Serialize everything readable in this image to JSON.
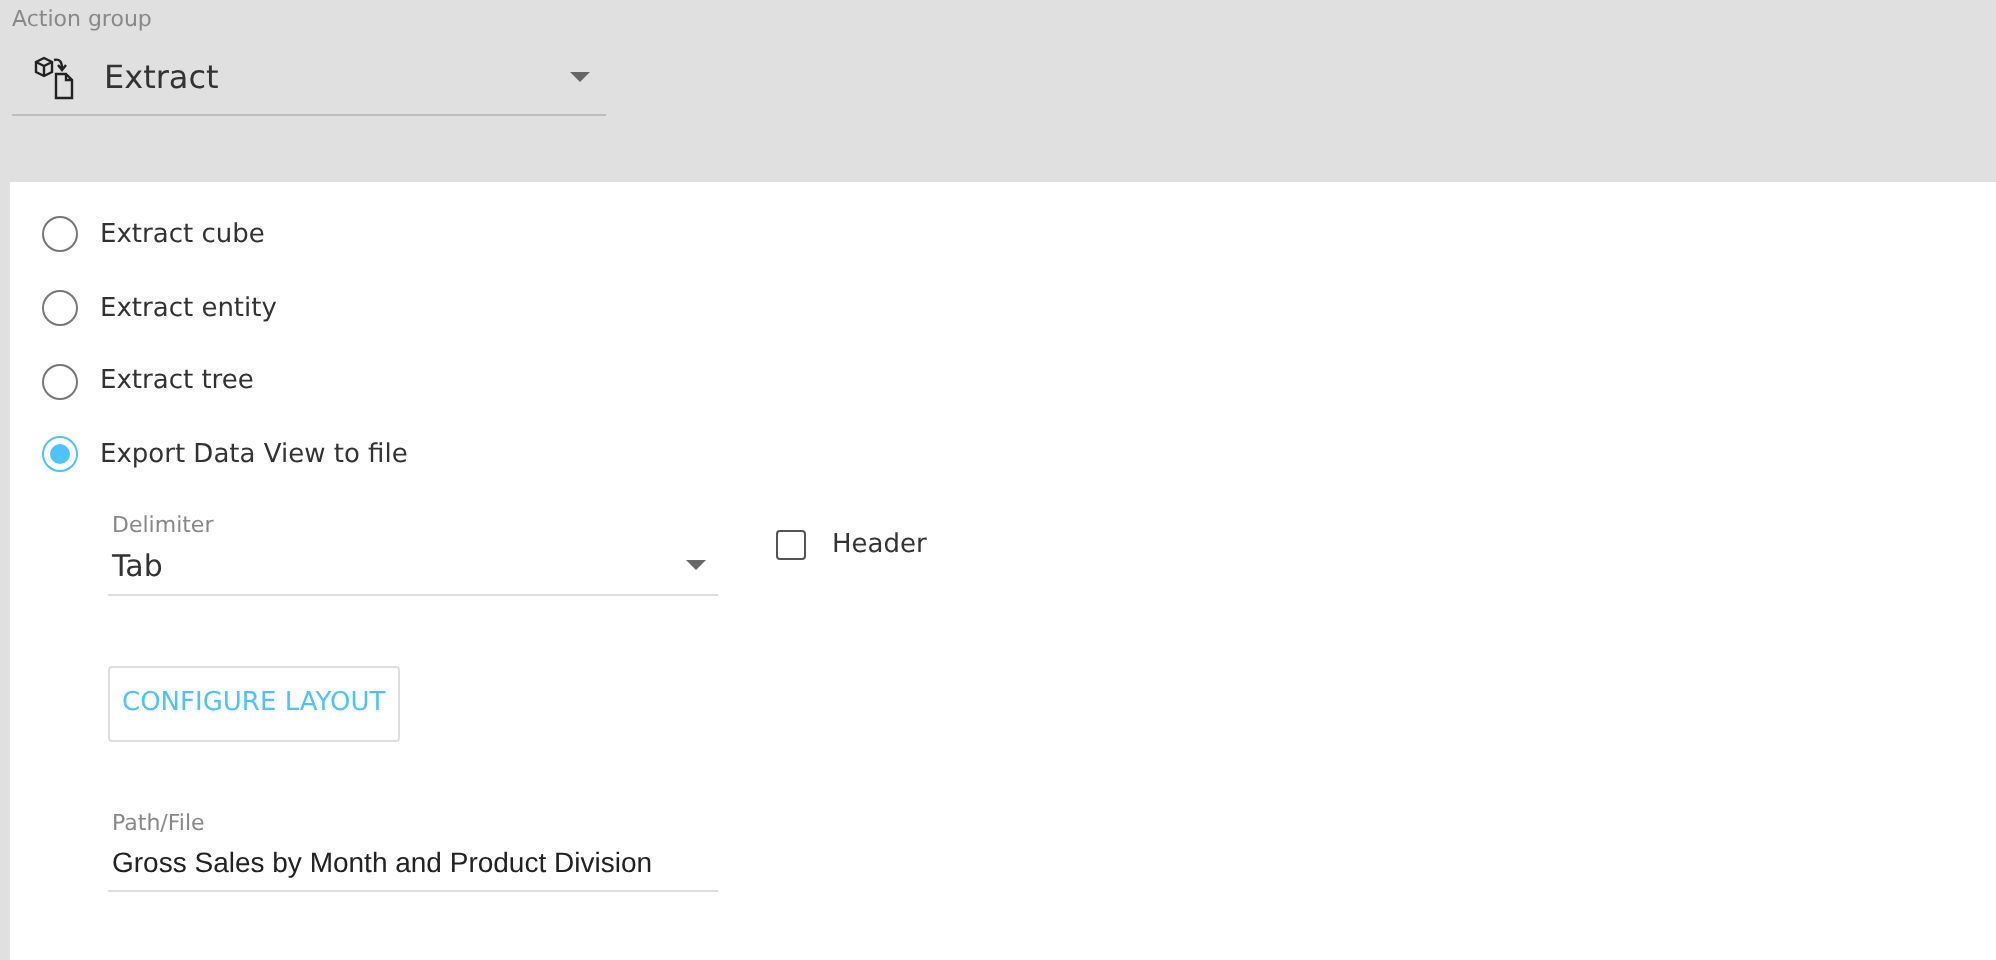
{
  "action_group": {
    "label": "Action group",
    "value": "Extract"
  },
  "options": [
    {
      "label": "Extract cube",
      "selected": false
    },
    {
      "label": "Extract entity",
      "selected": false
    },
    {
      "label": "Extract tree",
      "selected": false
    },
    {
      "label": "Export Data View to file",
      "selected": true
    }
  ],
  "delimiter": {
    "label": "Delimiter",
    "value": "Tab"
  },
  "header": {
    "label": "Header",
    "checked": false
  },
  "configure_button": "CONFIGURE LAYOUT",
  "path_file": {
    "label": "Path/File",
    "value": "Gross Sales by Month and Product Division"
  }
}
